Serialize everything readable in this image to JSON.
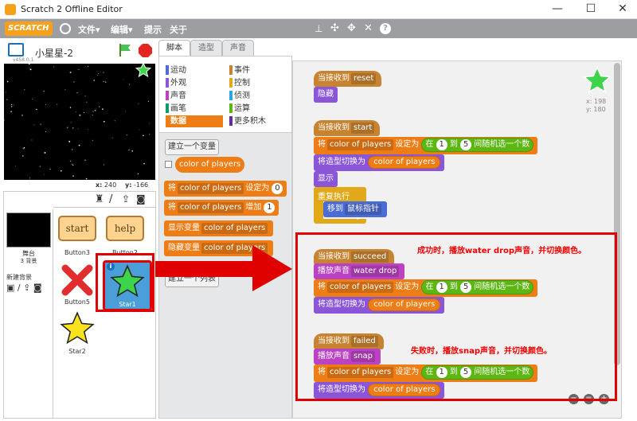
{
  "window": {
    "title": "Scratch 2 Offline Editor",
    "minimize": "—",
    "maximize": "☐",
    "close": "✕"
  },
  "menu": {
    "logo": "SCRATCH",
    "file": "文件",
    "edit": "编辑",
    "tips": "提示",
    "about": "关于",
    "dropdown_glyph": "▾"
  },
  "stage": {
    "project_name": "小星星-2",
    "version": "v458.0.1",
    "x_label": "x:",
    "x_value": "240",
    "y_label": "y:",
    "y_value": "-166"
  },
  "sprites_panel": {
    "stage_label": "舞台",
    "stage_sub": "3 背景",
    "new_backdrop": "新建背景",
    "sprites": [
      {
        "name": "Button3",
        "text": "start"
      },
      {
        "name": "Button2",
        "text": "help"
      },
      {
        "name": "Button5",
        "text": ""
      },
      {
        "name": "Star1",
        "text": ""
      },
      {
        "name": "Star2",
        "text": ""
      }
    ]
  },
  "tabs": [
    {
      "label": "脚本"
    },
    {
      "label": "造型"
    },
    {
      "label": "声音"
    }
  ],
  "categories": [
    {
      "label": "运动",
      "color": "#4a6cd4"
    },
    {
      "label": "事件",
      "color": "#c88330"
    },
    {
      "label": "外观",
      "color": "#8a55d7"
    },
    {
      "label": "控制",
      "color": "#e1a91a"
    },
    {
      "label": "声音",
      "color": "#bb42c3"
    },
    {
      "label": "侦测",
      "color": "#2ca5e2"
    },
    {
      "label": "画笔",
      "color": "#0e9a6c"
    },
    {
      "label": "运算",
      "color": "#5cb712"
    },
    {
      "label": "数据",
      "color": "#ee7d16"
    },
    {
      "label": "更多积木",
      "color": "#632d99"
    }
  ],
  "palette": {
    "make_variable": "建立一个变量",
    "variable_name": "color of players",
    "set_prefix": "将",
    "set_suffix": "设定为",
    "set_value": "0",
    "change_prefix": "将",
    "change_suffix": "增加",
    "change_value": "1",
    "show_var": "显示变量",
    "hide_var": "隐藏变量",
    "make_list": "建立一个列表"
  },
  "sprite_info": {
    "x": "x: 198",
    "y": "y: 180"
  },
  "scripts": {
    "when_receive": "当接收到",
    "hide": "隐藏",
    "show": "显示",
    "forever": "重复执行",
    "goto": "移到",
    "mouse_pointer": "鼠标指针",
    "set": "将",
    "set_to": "设定为",
    "var": "color of players",
    "in": "在",
    "to": "到",
    "random_suffix": "间随机选一个数",
    "rand_from": "1",
    "rand_to": "5",
    "switch_costume": "将造型切换为",
    "play_sound": "播放声音",
    "msg_reset": "reset",
    "msg_start": "start",
    "msg_succeed": "succeed",
    "msg_failed": "failed",
    "sound_water": "water drop",
    "sound_snap": "snap"
  },
  "annotations": {
    "success": "成功时，播放water drop声音，并切换颜色。",
    "fail": "失败时，播放snap声音，并切换颜色。"
  },
  "zoom": {
    "out": "−",
    "reset": "=",
    "in": "+"
  },
  "colors": {
    "menubar": "#9c9ea2",
    "highlight_red": "#e00000",
    "data": "#ee7d16",
    "events": "#c88330",
    "looks": "#8a55d7",
    "sound": "#bb42c3",
    "operators": "#5cb712",
    "motion": "#4a6cd4",
    "control": "#e1a91a"
  }
}
